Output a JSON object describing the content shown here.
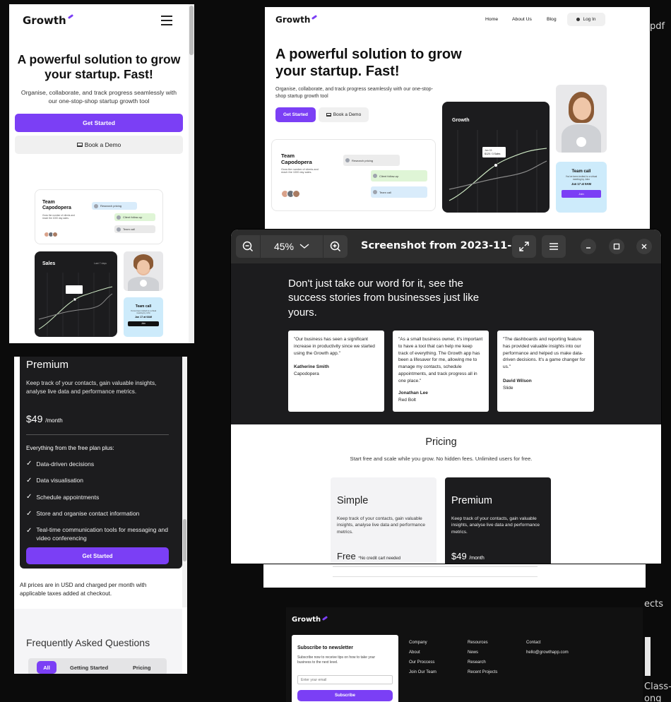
{
  "brand": {
    "name": "Growth",
    "accent": "#7b3ff5"
  },
  "hero": {
    "title": "A powerful solution to grow your startup. Fast!",
    "subtitle": "Organise, collaborate, and track progress seamlessly with our one-stop-shop startup growth tool",
    "primary_cta": "Get Started",
    "secondary_cta": "Book a Demo"
  },
  "nav": {
    "home": "Home",
    "about": "About Us",
    "blog": "Blog",
    "login": "Log In"
  },
  "team_card": {
    "title": "Team Capodopera",
    "desc": "Grow the number of clients and reach the 1000 day sales.",
    "tasks": [
      "Research pricing",
      "Client follow-up",
      "Team call"
    ]
  },
  "sales_card": {
    "title_desktop": "Growth",
    "title_mobile": "Sales",
    "filter": "Last 7 days",
    "tooltip_date": "Jan 15",
    "tooltip_value": "$120 / 3 Sales"
  },
  "call_card": {
    "title": "Team call",
    "desc": "You've been invited to a virtual meeting by John",
    "date": "Jan 17 at 9AM",
    "button": "Join"
  },
  "viewer": {
    "zoom": "45%",
    "title": "Screenshot from 2023-11-..."
  },
  "testimonials": {
    "heading": "Don't just take our word for it, see the success stories from businesses just like yours.",
    "items": [
      {
        "quote": "\"Our business has seen a significant increase in productivity since we started using the Growth app.\"",
        "name": "Katherine Smith",
        "company": "Capodopera"
      },
      {
        "quote": "\"As a small business owner, it's important to have a tool that can help me keep track of everything. The Growth app has been a lifesaver for me, allowing me to manage my contacts, schedule appointments, and track progress all in one place.\"",
        "name": "Jonathan Lee",
        "company": "Red Bolt"
      },
      {
        "quote": "\"The dashboards and reporting feature has provided valuable insights into our performance and helped us make data-driven decisions. It's a game changer for us.\"",
        "name": "David Wilson",
        "company": "Slide"
      }
    ]
  },
  "pricing": {
    "heading": "Pricing",
    "sub": "Start free and scale while you grow. No hidden fees. Unlimited users for free.",
    "simple": {
      "name": "Simple",
      "desc": "Keep track of your contacts, gain valuable insights, analyse live data and performance metrics.",
      "price": "Free",
      "note": "*No credit cart needed"
    },
    "premium": {
      "name": "Premium",
      "desc": "Keep track of your contacts, gain valuable insights, analyse live data and performance metrics.",
      "price": "$49",
      "period": "/month"
    }
  },
  "premium_mobile": {
    "name": "Premium",
    "desc": "Keep track of your contacts, gain valuable insights, analyse live data and performance metrics.",
    "price": "$49",
    "period": "/month",
    "includes": "Everything from the free plan plus:",
    "features": [
      "Data-driven decisions",
      "Data visualisation",
      "Schedule appointments",
      "Store and organise contact information",
      "Teal-time communication tools for messaging and video conferencing"
    ],
    "cta": "Get Started",
    "footnote": "All prices are in USD and charged per month with applicable taxes added at checkout."
  },
  "faq": {
    "heading": "Frequently Asked Questions",
    "tabs": [
      "All",
      "Getting Started",
      "Pricing"
    ]
  },
  "footer": {
    "newsletter_title": "Subscribe to newsletter",
    "newsletter_desc": "Subscribe now to receive tips on how to take your business to the next level.",
    "email_placeholder": "Enter your email",
    "subscribe": "Subscribe",
    "company": [
      "Company",
      "About",
      "Our Proccess",
      "Join Our Team"
    ],
    "resources": [
      "Resources",
      "News",
      "Research",
      "Recent Projects"
    ],
    "contact": [
      "Contact",
      "hello@growthapp.com"
    ]
  },
  "desktop_fragments": {
    "pdf": "pdf",
    "ects": "ects",
    "class": "Class-",
    "ong": "ong"
  }
}
